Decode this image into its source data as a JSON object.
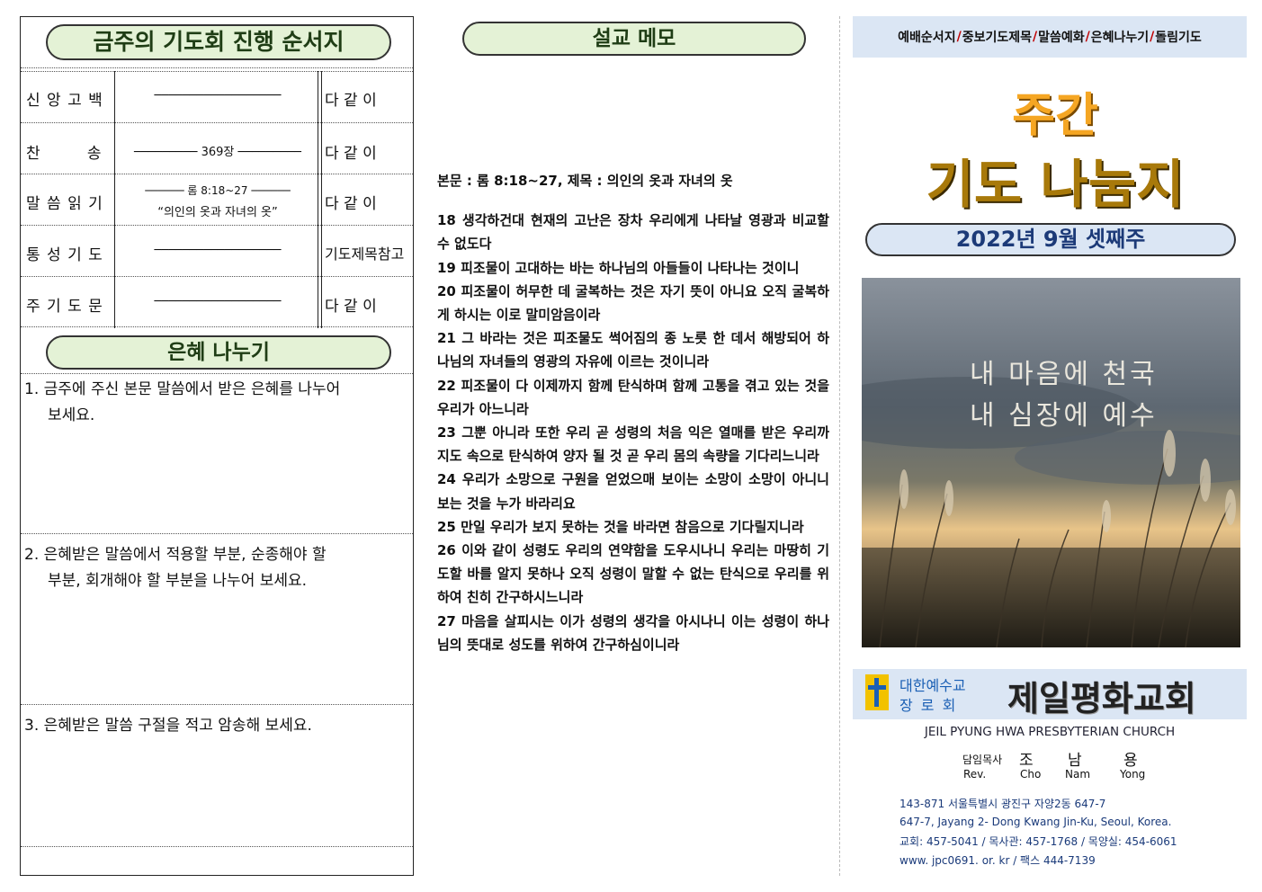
{
  "left": {
    "heading": "금주의 기도회 진행 순서지",
    "order_rows": [
      {
        "label": "신 앙 고 백",
        "middle": "──────────────────",
        "right": "다  같  이"
      },
      {
        "label": "찬        송",
        "middle": "─────────  369장  ─────────",
        "right": "다  같  이"
      },
      {
        "label": "말 씀 읽 기",
        "middle": "────── 롬 8:18~27  ──────",
        "middle2": "“의인의 옷과 자녀의 옷”",
        "right": "다  같  이"
      },
      {
        "label": "통 성 기 도",
        "middle": "──────────────────",
        "right": "기도제목참고"
      },
      {
        "label": "주 기 도 문",
        "middle": "──────────────────",
        "right": "다  같  이"
      }
    ],
    "grace_heading": "은혜 나누기",
    "grace_questions": [
      {
        "num": "1.",
        "line1": "금주에 주신 본문 말씀에서 받은 은혜를 나누어",
        "line2": "보세요."
      },
      {
        "num": "2.",
        "line1": "은혜받은 말씀에서 적용할 부분, 순종해야 할",
        "line2": "부분, 회개해야 할 부분을 나누어 보세요."
      },
      {
        "num": "3.",
        "line1": "은혜받은 말씀 구절을 적고 암송해 보세요.",
        "line2": ""
      }
    ]
  },
  "middle": {
    "heading": "설교 메모",
    "passage_line": "본문 : 롬 8:18~27, 제목 : 의인의 옷과 자녀의 옷",
    "verses": [
      "18 생각하건대 현재의 고난은 장차 우리에게 나타날 영광과 비교할 수 없도다",
      "19 피조물이 고대하는 바는 하나님의 아들들이 나타나는 것이니",
      "20 피조물이 허무한 데 굴복하는 것은 자기 뜻이 아니요 오직 굴복하게 하시는 이로 말미암음이라",
      "21 그 바라는 것은 피조물도 썩어짐의 종 노릇 한 데서 해방되어 하나님의 자녀들의 영광의 자유에 이르는 것이니라",
      "22 피조물이 다 이제까지 함께 탄식하며 함께 고통을 겪고 있는 것을 우리가 아느니라",
      "23 그뿐 아니라 또한 우리 곧 성령의 처음 익은 열매를 받은 우리까지도 속으로 탄식하여 양자 될 것 곧 우리 몸의 속량을 기다리느니라",
      "24 우리가 소망으로 구원을 얻었으매 보이는 소망이 소망이 아니니 보는 것을 누가 바라리요",
      "25 만일 우리가 보지 못하는 것을 바라면 참음으로 기다릴지니라",
      "26 이와 같이 성령도 우리의 연약함을 도우시나니 우리는 마땅히 기도할 바를 알지 못하나 오직 성령이 말할 수 없는 탄식으로 우리를 위하여 친히 간구하시느니라",
      "27 마음을 살피시는 이가 성령의 생각을 아시나니 이는 성령이 하나님의 뜻대로 성도를 위하여 간구하심이니라"
    ]
  },
  "right": {
    "tabs": [
      "예배순서지",
      "중보기도제목",
      "말씀예화",
      "은혜나누기",
      "돌림기도"
    ],
    "title1": "주간",
    "title2": "기도 나눔지",
    "date": "2022년 9월 셋째주",
    "photo_text1": "내 마음에 천국",
    "photo_text2": "내 심장에 예수",
    "denomination1": "대한예수교",
    "denomination2": "장 로 회",
    "church_name": "제일평화교회",
    "church_english": "JEIL PYUNG HWA PRESBYTERIAN CHURCH",
    "pastor_label": "담임목사",
    "pastor_name": [
      "조",
      "남",
      "용"
    ],
    "pastor_rev": "Rev.",
    "pastor_eng": [
      "Cho",
      "Nam",
      "Yong"
    ],
    "address_kr": "143-871 서울특별시 광진구 자양2동 647-7",
    "address_en": "647-7, Jayang 2- Dong Kwang Jin-Ku, Seoul, Korea.",
    "phones": "교회: 457-5041 / 목사관: 457-1768 / 목양실: 454-6061",
    "web": "www. jpc0691. or. kr / 팩스 444-7139"
  },
  "colors": {
    "pill_green": "#e4f2d6",
    "light_blue": "#dbe6f4",
    "title_orange": "#f5a623",
    "title_olive": "#a8790a",
    "separator_red": "#c00000",
    "date_navy": "#1c3a78"
  }
}
